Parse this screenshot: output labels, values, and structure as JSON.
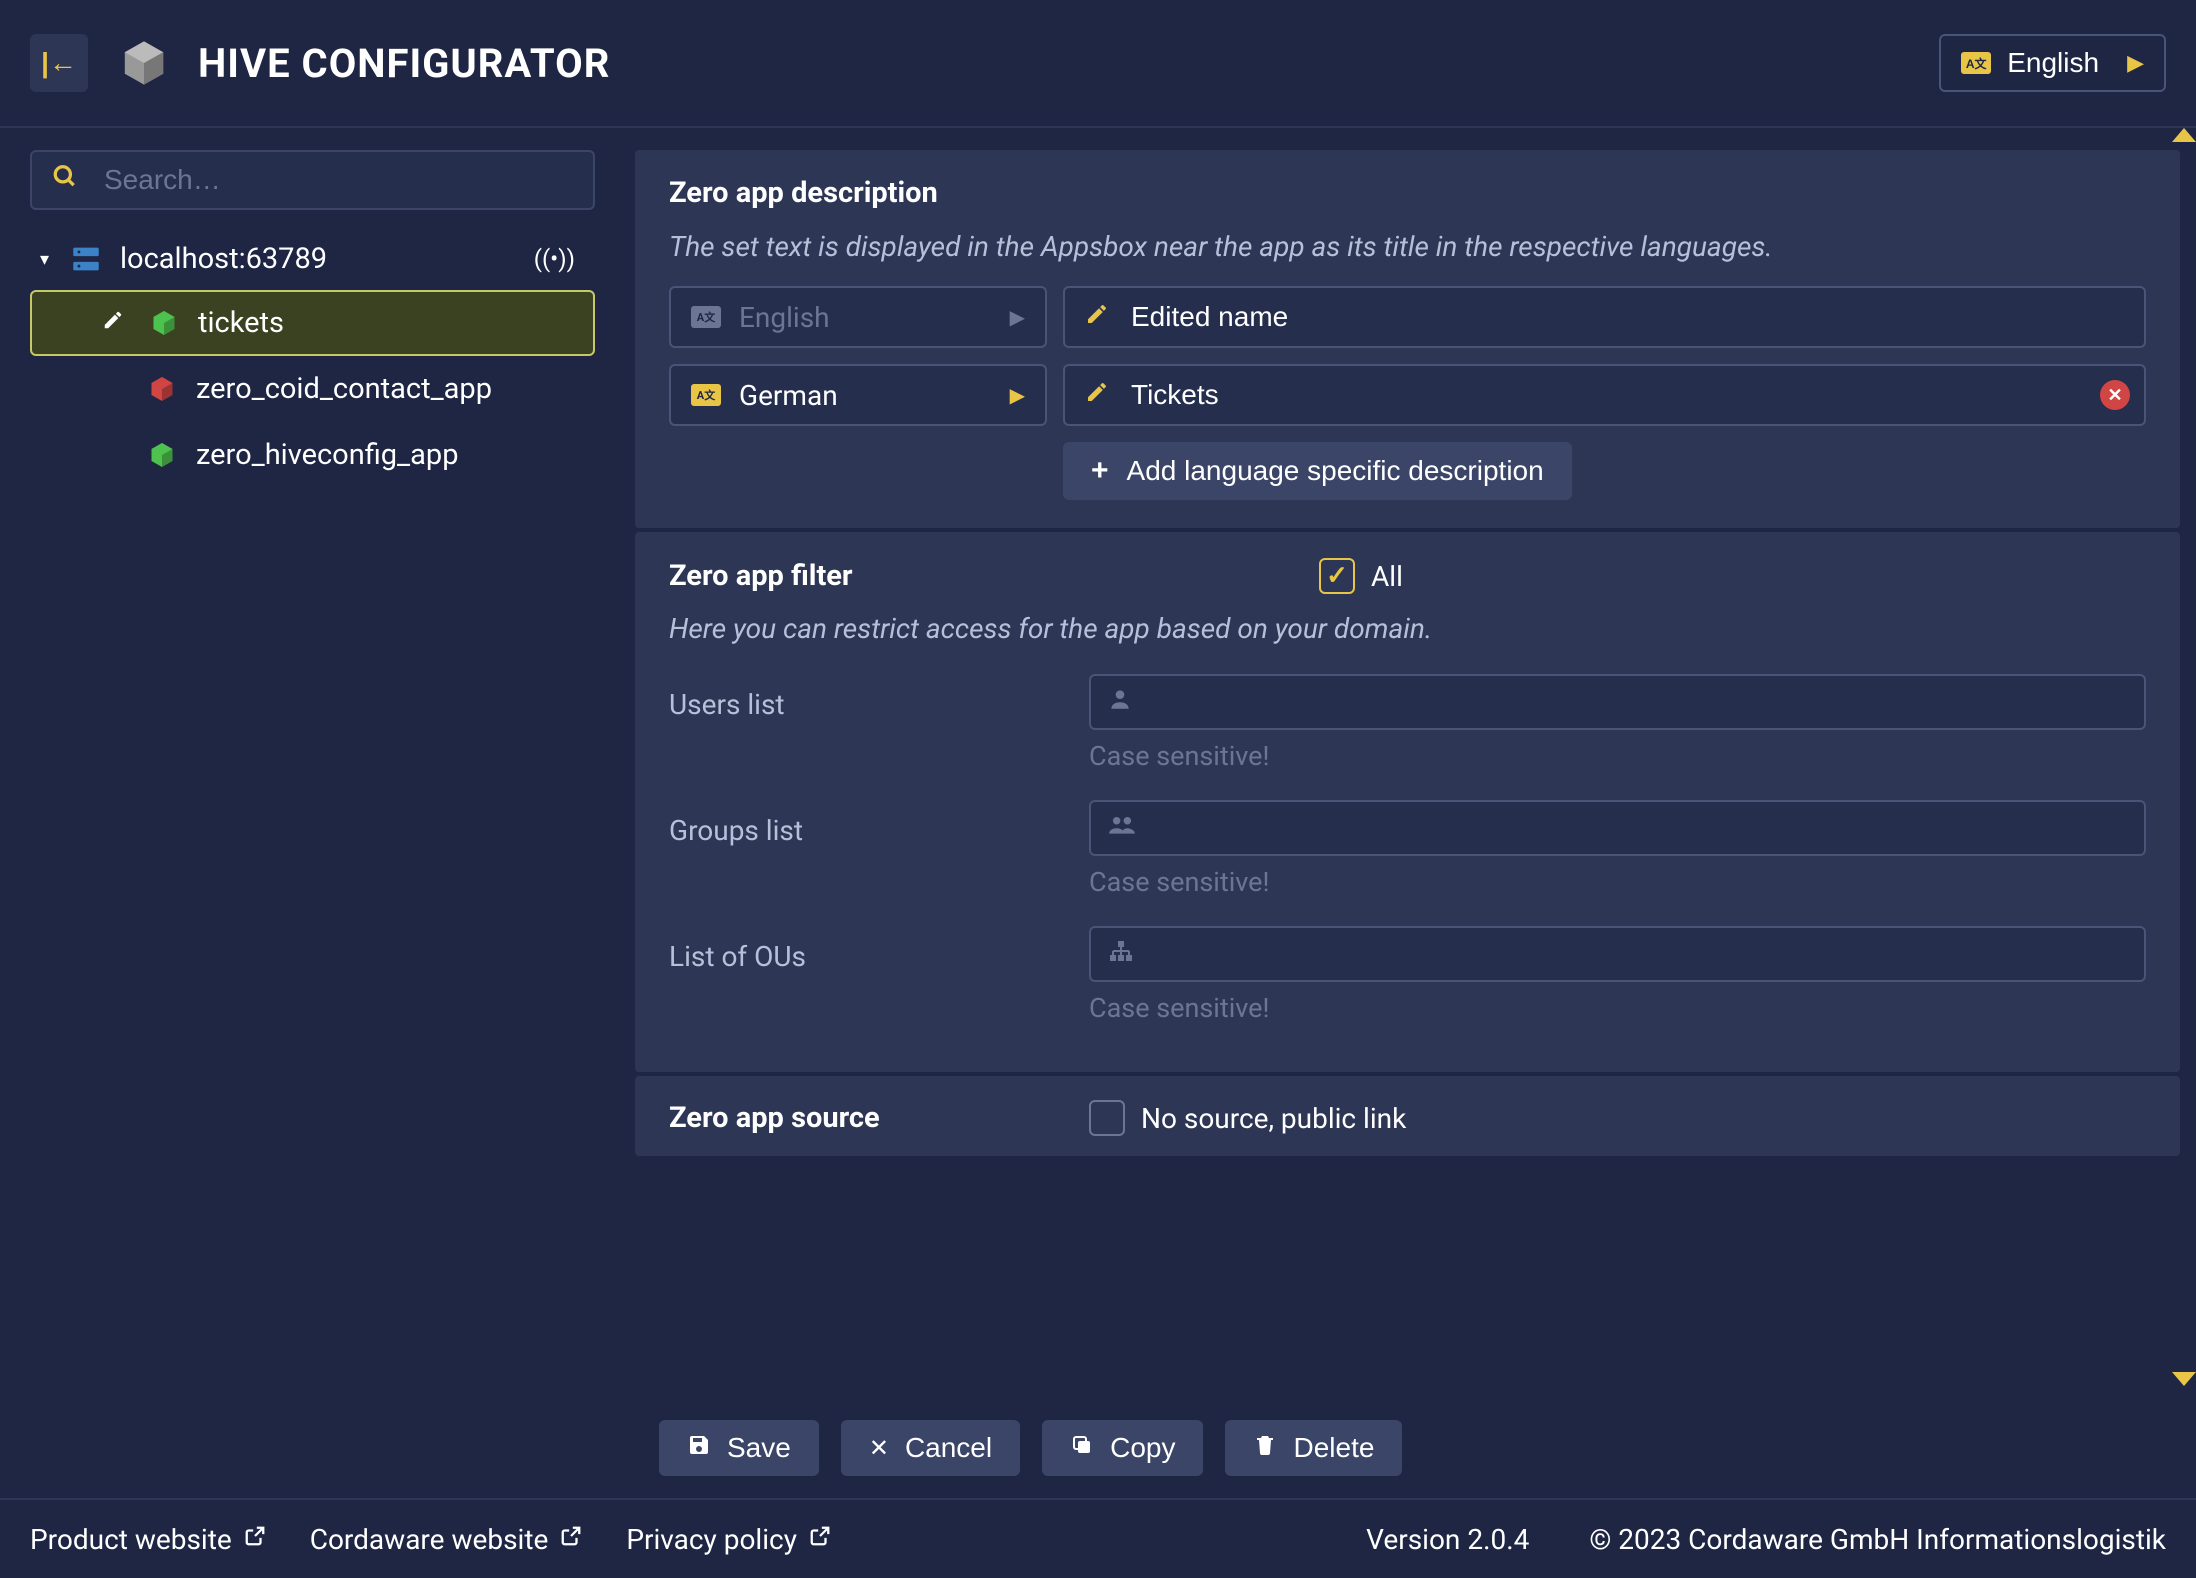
{
  "header": {
    "title": "HIVE CONFIGURATOR",
    "language_label": "English"
  },
  "sidebar": {
    "search_placeholder": "Search…",
    "root": {
      "label": "localhost:63789"
    },
    "items": [
      {
        "label": "tickets",
        "color": "green",
        "selected": true
      },
      {
        "label": "zero_coid_contact_app",
        "color": "red",
        "selected": false
      },
      {
        "label": "zero_hiveconfig_app",
        "color": "green",
        "selected": false
      }
    ]
  },
  "description_panel": {
    "title": "Zero app description",
    "subtitle": "The set text is displayed in the Appsbox near the app as its title in the respective languages.",
    "rows": [
      {
        "lang": "English",
        "active": false,
        "value": "Edited name",
        "clearable": false
      },
      {
        "lang": "German",
        "active": true,
        "value": "Tickets",
        "clearable": true
      }
    ],
    "add_button": "Add language specific description"
  },
  "filter_panel": {
    "title": "Zero app filter",
    "all_label": "All",
    "all_checked": true,
    "subtitle": "Here you can restrict access for the app based on your domain.",
    "fields": [
      {
        "label": "Users list",
        "icon": "user",
        "hint": "Case sensitive!"
      },
      {
        "label": "Groups list",
        "icon": "group",
        "hint": "Case sensitive!"
      },
      {
        "label": "List of OUs",
        "icon": "org",
        "hint": "Case sensitive!"
      }
    ]
  },
  "source_panel": {
    "title": "Zero app source",
    "checkbox_label": "No source, public link",
    "checked": false
  },
  "actions": {
    "save": "Save",
    "cancel": "Cancel",
    "copy": "Copy",
    "delete": "Delete"
  },
  "footer": {
    "links": [
      "Product website",
      "Cordaware website",
      "Privacy policy"
    ],
    "version": "Version 2.0.4",
    "copyright": "© 2023 Cordaware GmbH Informationslogistik"
  }
}
